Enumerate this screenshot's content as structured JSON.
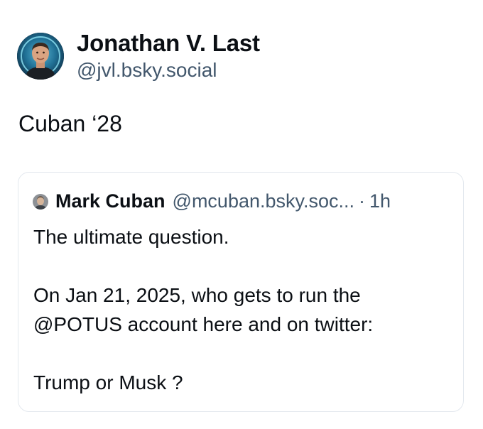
{
  "post": {
    "author": {
      "display_name": "Jonathan V. Last",
      "handle": "@jvl.bsky.social",
      "avatar_icon": "person-avatar"
    },
    "text": "Cuban ‘28",
    "quote": {
      "author": {
        "display_name": "Mark Cuban",
        "handle": "@mcuban.bsky.soc...",
        "avatar_icon": "person-avatar-small"
      },
      "separator": "·",
      "time": "1h",
      "lines": [
        "The ultimate question.",
        "On Jan 21, 2025, who gets to run the",
        "@POTUS account here and on twitter:",
        "Trump or Musk ?"
      ]
    }
  },
  "colors": {
    "text_primary": "#0b0f14",
    "text_secondary": "#42576c",
    "card_border": "#e3e8ee",
    "background": "#ffffff"
  }
}
